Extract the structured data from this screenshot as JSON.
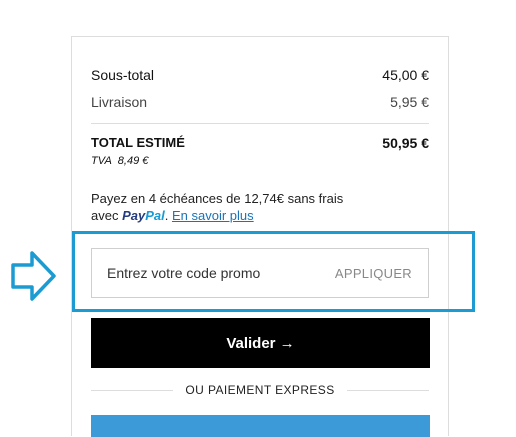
{
  "summary": {
    "subtotal_label": "Sous-total",
    "subtotal_value": "45,00 €",
    "shipping_label": "Livraison",
    "shipping_value": "5,95 €",
    "total_label": "TOTAL ESTIMÉ",
    "total_value": "50,95 €",
    "vat_label": "TVA",
    "vat_value": "8,49 €"
  },
  "paypal": {
    "text_line1": "Payez en 4 échéances de 12,74€ sans frais",
    "text_avec": "avec",
    "logo_pay": "Pay",
    "logo_pal": "Pal",
    "learn_more": "En savoir plus"
  },
  "promo": {
    "placeholder": "Entrez votre code promo",
    "apply_label": "APPLIQUER"
  },
  "actions": {
    "validate_label": "Valider →",
    "express_label": "OU PAIEMENT EXPRESS"
  },
  "colors": {
    "highlight": "#1b9bd2",
    "express_button": "#3d9ad8",
    "paypal_blue_dark": "#253b80",
    "paypal_blue_light": "#179bd7"
  },
  "icons": {
    "annotation_arrow": "arrow-right-outline-icon"
  }
}
